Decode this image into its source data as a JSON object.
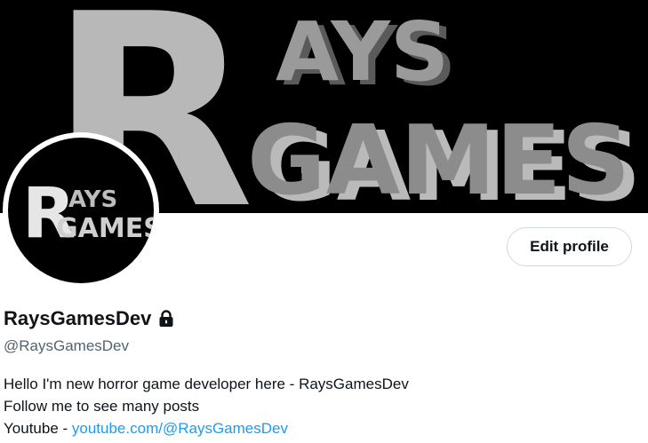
{
  "banner": {
    "line1": "AYS",
    "line2": "GAMES",
    "initial": "R"
  },
  "avatar": {
    "line1": "AYS",
    "line2": "GAMES",
    "initial": "R"
  },
  "profile": {
    "edit_label": "Edit profile",
    "display_name": "RaysGamesDev",
    "handle": "@RaysGamesDev",
    "protected_icon": "lock-icon"
  },
  "bio": {
    "line1": "Hello I'm new horror game developer here - RaysGamesDev",
    "line2": "Follow me to see many posts",
    "line3_prefix": "Youtube - ",
    "link_text": "youtube.com/@RaysGamesDev"
  },
  "colors": {
    "link": "#1d9bf0",
    "secondary_text": "#536471",
    "banner_bg": "#000000",
    "logo_gray": "#8a8a8a"
  }
}
